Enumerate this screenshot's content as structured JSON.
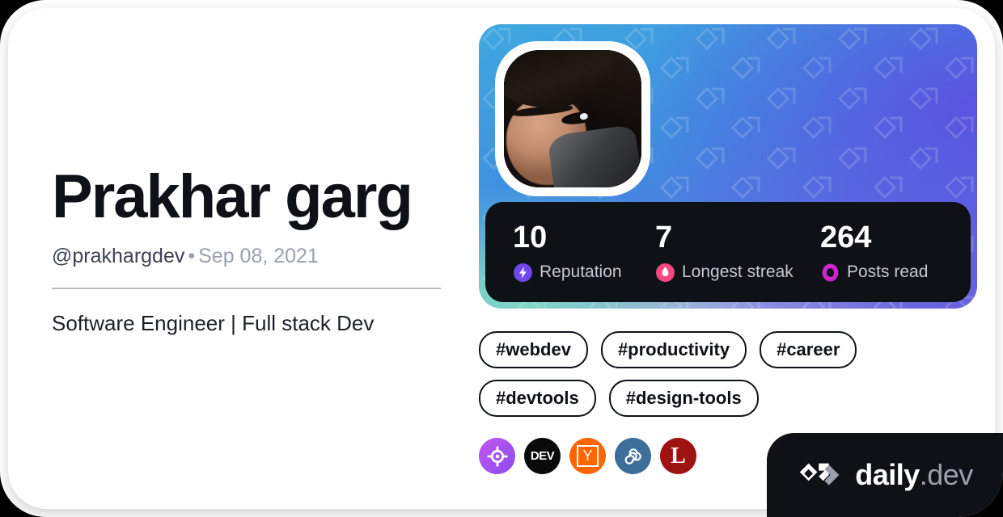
{
  "profile": {
    "display_name": "Prakhar garg",
    "handle": "@prakhargdev",
    "separator": "•",
    "joined_date": "Sep 08, 2021",
    "bio": "Software Engineer | Full stack Dev",
    "avatar_alt": "user-avatar"
  },
  "stats": [
    {
      "value": "10",
      "label": "Reputation",
      "icon": "reputation-bolt-icon",
      "color": "#7147ed"
    },
    {
      "value": "7",
      "label": "Longest streak",
      "icon": "streak-flame-icon",
      "color": "#f5487f"
    },
    {
      "value": "264",
      "label": "Posts read",
      "icon": "posts-read-ring-icon",
      "color": "#cf25cf"
    }
  ],
  "tags": [
    {
      "label": "#webdev"
    },
    {
      "label": "#productivity"
    },
    {
      "label": "#career"
    },
    {
      "label": "#devtools"
    },
    {
      "label": "#design-tools"
    }
  ],
  "sources": [
    {
      "name": "daily-dev-source-icon",
      "text": ""
    },
    {
      "name": "dev-to-source-icon",
      "text": "DEV"
    },
    {
      "name": "hacker-news-source-icon",
      "text": "Y"
    },
    {
      "name": "infinity-source-icon",
      "text": ""
    },
    {
      "name": "logrocket-source-icon",
      "text": "L"
    }
  ],
  "brand": {
    "name": "daily",
    "suffix": ".dev"
  },
  "theme": {
    "dark": "#0e1217",
    "muted": "#9aa1ad",
    "divider": "#bcbdc2",
    "cover_from": "#3fa8e0",
    "cover_to": "#6d62dd"
  }
}
